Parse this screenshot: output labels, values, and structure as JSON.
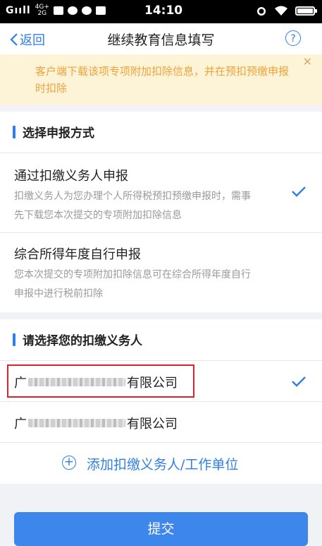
{
  "status_bar": {
    "signal": "Gııll",
    "network_top": "4G+",
    "network_bottom": "2G",
    "time": "14:10"
  },
  "navbar": {
    "back_label": "返回",
    "title": "继续教育信息填写",
    "help_label": "?"
  },
  "notice": {
    "text": "客户端下载该项专项附加扣除信息，并在预扣预缴申报时扣除",
    "close": "×"
  },
  "report_method": {
    "heading": "选择申报方式",
    "options": [
      {
        "title": "通过扣缴义务人申报",
        "description": "扣缴义务人为您办理个人所得税预扣预缴申报时，需事先下载您本次提交的专项附加扣除信息",
        "selected": true
      },
      {
        "title": "综合所得年度自行申报",
        "description": "您本次提交的专项附加扣除信息可在综合所得年度自行申报中进行税前扣除",
        "selected": false
      }
    ]
  },
  "withholding_agent": {
    "heading": "请选择您的扣缴义务人",
    "agents": [
      {
        "prefix": "广",
        "suffix": "有限公司",
        "selected": true
      },
      {
        "prefix": "广",
        "suffix": "有限公司",
        "selected": false
      }
    ],
    "add_label": "添加扣缴义务人/工作单位"
  },
  "submit_label": "提交",
  "colors": {
    "accent": "#2f7fe6",
    "notice_bg": "#fdf4d8",
    "notice_text": "#f0a23a",
    "highlight": "#d8232a"
  }
}
